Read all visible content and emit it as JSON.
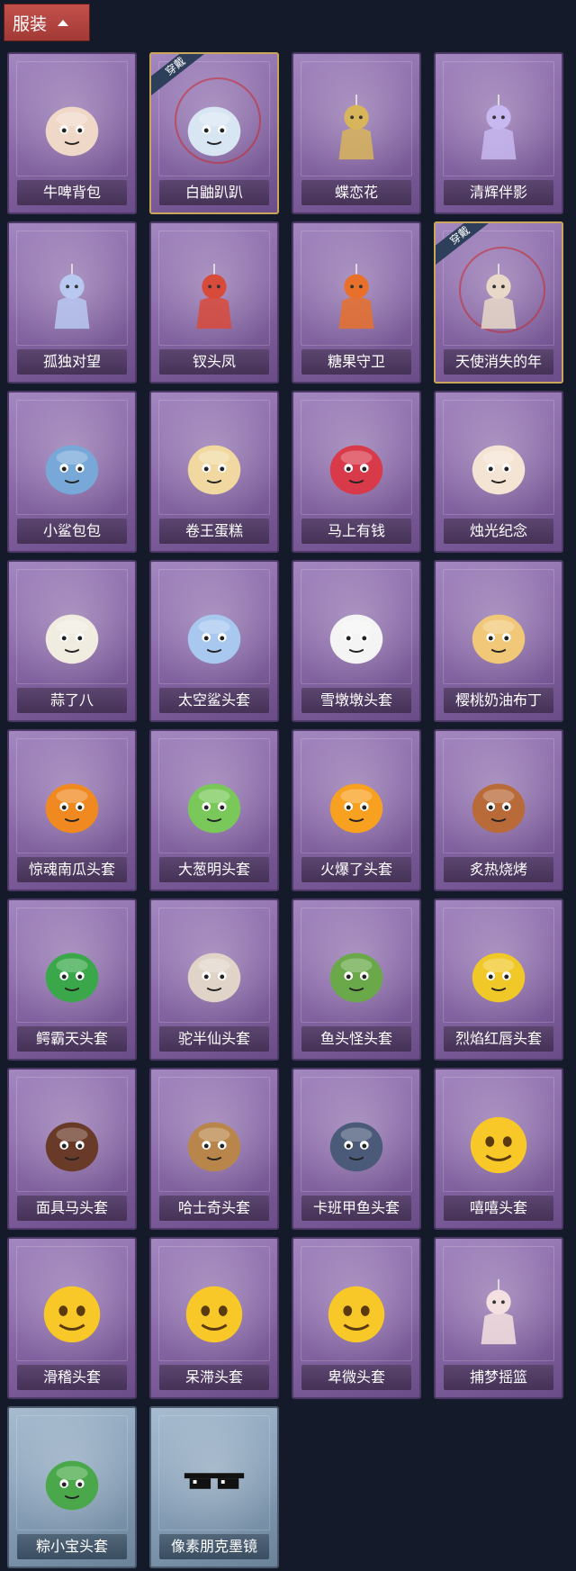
{
  "header": {
    "tab_label": "服装"
  },
  "badge_text": "穿戴",
  "items": [
    {
      "label": "牛啤背包",
      "icon": "cow-beer-keg-icon",
      "theme": "purple",
      "equipped": false,
      "color": "#f0d8c8"
    },
    {
      "label": "白鼬趴趴",
      "icon": "white-ermine-plush-icon",
      "theme": "purple",
      "equipped": true,
      "color": "#d8e6f4"
    },
    {
      "label": "蝶恋花",
      "icon": "butterfly-flower-charm-icon",
      "theme": "purple",
      "equipped": false,
      "color": "#d8b45a"
    },
    {
      "label": "清辉伴影",
      "icon": "moon-spirit-figure-icon",
      "theme": "purple",
      "equipped": false,
      "color": "#c8b8f0"
    },
    {
      "label": "孤独对望",
      "icon": "lonely-gaze-figure-icon",
      "theme": "purple",
      "equipped": false,
      "color": "#b8c8f0"
    },
    {
      "label": "钗头凤",
      "icon": "phoenix-crown-doll-icon",
      "theme": "purple",
      "equipped": false,
      "color": "#d84a3a"
    },
    {
      "label": "糖果守卫",
      "icon": "pumpkin-candy-guard-icon",
      "theme": "purple",
      "equipped": false,
      "color": "#e8702a"
    },
    {
      "label": "天使消失的年",
      "icon": "angel-figure-icon",
      "theme": "purple",
      "equipped": true,
      "color": "#e8d8c8"
    },
    {
      "label": "小鲨包包",
      "icon": "shark-bag-icon",
      "theme": "purple",
      "equipped": false,
      "color": "#78a8d8"
    },
    {
      "label": "卷王蛋糕",
      "icon": "roll-cake-icon",
      "theme": "purple",
      "equipped": false,
      "color": "#f0d8a0"
    },
    {
      "label": "马上有钱",
      "icon": "red-horse-head-icon",
      "theme": "purple",
      "equipped": false,
      "color": "#d83a4a"
    },
    {
      "label": "烛光纪念",
      "icon": "candle-icon",
      "theme": "purple",
      "equipped": false,
      "color": "#f4e4d4"
    },
    {
      "label": "蒜了八",
      "icon": "garlic-head-icon",
      "theme": "purple",
      "equipped": false,
      "color": "#f0ece0"
    },
    {
      "label": "太空鲨头套",
      "icon": "space-shark-head-icon",
      "theme": "purple",
      "equipped": false,
      "color": "#a8c8f0"
    },
    {
      "label": "雪墩墩头套",
      "icon": "snowman-head-icon",
      "theme": "purple",
      "equipped": false,
      "color": "#f4f4f4"
    },
    {
      "label": "樱桃奶油布丁",
      "icon": "cherry-pudding-head-icon",
      "theme": "purple",
      "equipped": false,
      "color": "#f0c878"
    },
    {
      "label": "惊魂南瓜头套",
      "icon": "pumpkin-head-icon",
      "theme": "purple",
      "equipped": false,
      "color": "#f08a20"
    },
    {
      "label": "大葱明头套",
      "icon": "scallion-head-icon",
      "theme": "purple",
      "equipped": false,
      "color": "#7ac85a"
    },
    {
      "label": "火爆了头套",
      "icon": "fire-head-icon",
      "theme": "purple",
      "equipped": false,
      "color": "#f8a020"
    },
    {
      "label": "炙热烧烤",
      "icon": "bbq-meat-head-icon",
      "theme": "purple",
      "equipped": false,
      "color": "#b86a38"
    },
    {
      "label": "鳄霸天头套",
      "icon": "crocodile-head-icon",
      "theme": "purple",
      "equipped": false,
      "color": "#3aa84a"
    },
    {
      "label": "驼半仙头套",
      "icon": "bear-sunglasses-head-icon",
      "theme": "purple",
      "equipped": false,
      "color": "#e0d4c8"
    },
    {
      "label": "鱼头怪头套",
      "icon": "fish-head-icon",
      "theme": "purple",
      "equipped": false,
      "color": "#6aa84a"
    },
    {
      "label": "烈焰红唇头套",
      "icon": "pikachu-lips-head-icon",
      "theme": "purple",
      "equipped": false,
      "color": "#f0c828"
    },
    {
      "label": "面具马头套",
      "icon": "horse-mask-head-icon",
      "theme": "purple",
      "equipped": false,
      "color": "#6a3a28"
    },
    {
      "label": "哈士奇头套",
      "icon": "husky-sunglasses-head-icon",
      "theme": "purple",
      "equipped": false,
      "color": "#b8864a"
    },
    {
      "label": "卡班甲鱼头套",
      "icon": "whale-fish-head-icon",
      "theme": "purple",
      "equipped": false,
      "color": "#4a5a78"
    },
    {
      "label": "嘻嘻头套",
      "icon": "grinning-emoji-head-icon",
      "theme": "purple",
      "equipped": false,
      "color": "#f8c828"
    },
    {
      "label": "滑稽头套",
      "icon": "funny-emoji-head-icon",
      "theme": "purple",
      "equipped": false,
      "color": "#f8c828"
    },
    {
      "label": "呆滞头套",
      "icon": "stunned-emoji-head-icon",
      "theme": "purple",
      "equipped": false,
      "color": "#f8c828"
    },
    {
      "label": "卑微头套",
      "icon": "humble-emoji-head-icon",
      "theme": "purple",
      "equipped": false,
      "color": "#f8c828"
    },
    {
      "label": "捕梦摇篮",
      "icon": "dream-cradle-figure-icon",
      "theme": "purple",
      "equipped": false,
      "color": "#f4e0e0"
    },
    {
      "label": "粽小宝头套",
      "icon": "zongzi-head-icon",
      "theme": "blue",
      "equipped": false,
      "color": "#4aa84a"
    },
    {
      "label": "像素朋克墨镜",
      "icon": "pixel-sunglasses-icon",
      "theme": "blue",
      "equipped": false,
      "color": "#111111"
    }
  ]
}
